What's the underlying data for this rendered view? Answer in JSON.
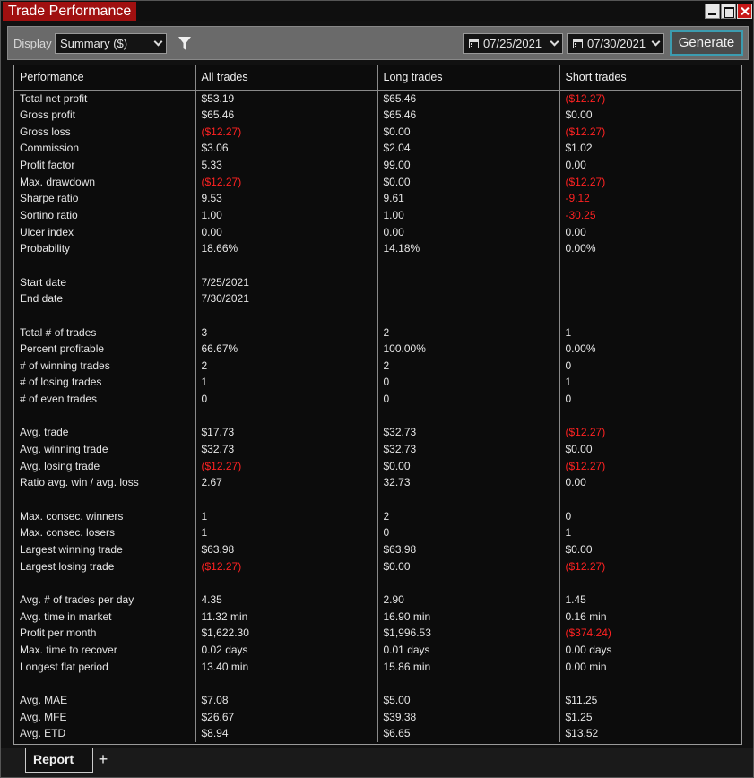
{
  "window": {
    "title": "Trade Performance"
  },
  "toolbar": {
    "display_label": "Display",
    "display_value": "Summary ($)",
    "start_date": "07/25/2021",
    "end_date": "07/30/2021",
    "generate_label": "Generate"
  },
  "table": {
    "headers": [
      "Performance",
      "All trades",
      "Long trades",
      "Short trades"
    ],
    "rows": [
      [
        "Total net profit",
        "$53.19",
        "$65.46",
        "($12.27)"
      ],
      [
        "Gross profit",
        "$65.46",
        "$65.46",
        "$0.00"
      ],
      [
        "Gross loss",
        "($12.27)",
        "$0.00",
        "($12.27)"
      ],
      [
        "Commission",
        "$3.06",
        "$2.04",
        "$1.02"
      ],
      [
        "Profit factor",
        "5.33",
        "99.00",
        "0.00"
      ],
      [
        "Max. drawdown",
        "($12.27)",
        "$0.00",
        "($12.27)"
      ],
      [
        "Sharpe ratio",
        "9.53",
        "9.61",
        "-9.12"
      ],
      [
        "Sortino ratio",
        "1.00",
        "1.00",
        "-30.25"
      ],
      [
        "Ulcer index",
        "0.00",
        "0.00",
        "0.00"
      ],
      [
        "Probability",
        "18.66%",
        "14.18%",
        "0.00%"
      ],
      [
        "",
        "",
        "",
        ""
      ],
      [
        "Start date",
        "7/25/2021",
        "",
        ""
      ],
      [
        "End date",
        "7/30/2021",
        "",
        ""
      ],
      [
        "",
        "",
        "",
        ""
      ],
      [
        "Total # of trades",
        "3",
        "2",
        "1"
      ],
      [
        "Percent profitable",
        "66.67%",
        "100.00%",
        "0.00%"
      ],
      [
        "# of winning trades",
        "2",
        "2",
        "0"
      ],
      [
        "# of losing trades",
        "1",
        "0",
        "1"
      ],
      [
        "# of even trades",
        "0",
        "0",
        "0"
      ],
      [
        "",
        "",
        "",
        ""
      ],
      [
        "Avg. trade",
        "$17.73",
        "$32.73",
        "($12.27)"
      ],
      [
        "Avg. winning trade",
        "$32.73",
        "$32.73",
        "$0.00"
      ],
      [
        "Avg. losing trade",
        "($12.27)",
        "$0.00",
        "($12.27)"
      ],
      [
        "Ratio avg. win / avg. loss",
        "2.67",
        "32.73",
        "0.00"
      ],
      [
        "",
        "",
        "",
        ""
      ],
      [
        "Max. consec. winners",
        "1",
        "2",
        "0"
      ],
      [
        "Max. consec. losers",
        "1",
        "0",
        "1"
      ],
      [
        "Largest winning trade",
        "$63.98",
        "$63.98",
        "$0.00"
      ],
      [
        "Largest losing trade",
        "($12.27)",
        "$0.00",
        "($12.27)"
      ],
      [
        "",
        "",
        "",
        ""
      ],
      [
        "Avg. # of trades per day",
        "4.35",
        "2.90",
        "1.45"
      ],
      [
        "Avg. time in market",
        "11.32 min",
        "16.90 min",
        "0.16 min"
      ],
      [
        "Profit per month",
        "$1,622.30",
        "$1,996.53",
        "($374.24)"
      ],
      [
        "Max. time to recover",
        "0.02 days",
        "0.01 days",
        "0.00 days"
      ],
      [
        "Longest flat period",
        "13.40 min",
        "15.86 min",
        "0.00 min"
      ],
      [
        "",
        "",
        "",
        ""
      ],
      [
        "Avg. MAE",
        "$7.08",
        "$5.00",
        "$11.25"
      ],
      [
        "Avg. MFE",
        "$26.67",
        "$39.38",
        "$1.25"
      ],
      [
        "Avg. ETD",
        "$8.94",
        "$6.65",
        "$13.52"
      ]
    ]
  },
  "tabs": {
    "active_label": "Report",
    "add_label": "+"
  },
  "colors": {
    "title_bg": "#a01010",
    "negative": "#ff2222",
    "accent_border": "#3c9cb0"
  },
  "icons": [
    "minimize-icon",
    "maximize-icon",
    "close-icon",
    "chevron-down-icon",
    "filter-icon",
    "calendar-icon"
  ]
}
